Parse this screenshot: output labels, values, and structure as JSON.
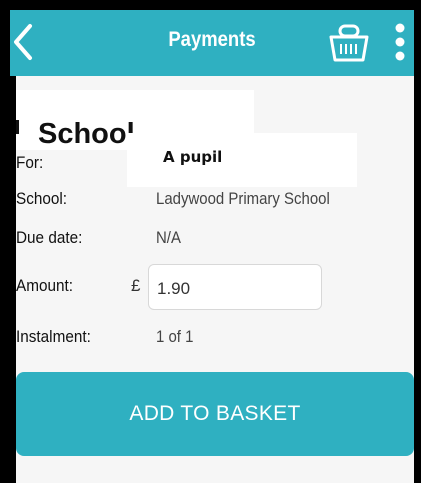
{
  "header": {
    "title": "Payments",
    "back_icon": "chevron-left-icon",
    "basket_icon": "basket-icon",
    "menu_icon": "more-vertical-icon"
  },
  "section": {
    "heading": "School"
  },
  "details": {
    "for_label": "For:",
    "for_value": "A pupil",
    "school_label": "School:",
    "school_value": "Ladywood Primary School",
    "due_label": "Due date:",
    "due_value": "N/A",
    "amount_label": "Amount:",
    "currency_symbol": "£",
    "amount_value": "1.90",
    "instalment_label": "Instalment:",
    "instalment_value": "1 of 1"
  },
  "actions": {
    "add_to_basket": "ADD TO BASKET"
  },
  "colors": {
    "accent": "#2fb0c1",
    "background": "#f6f6f6",
    "text": "#111111"
  }
}
